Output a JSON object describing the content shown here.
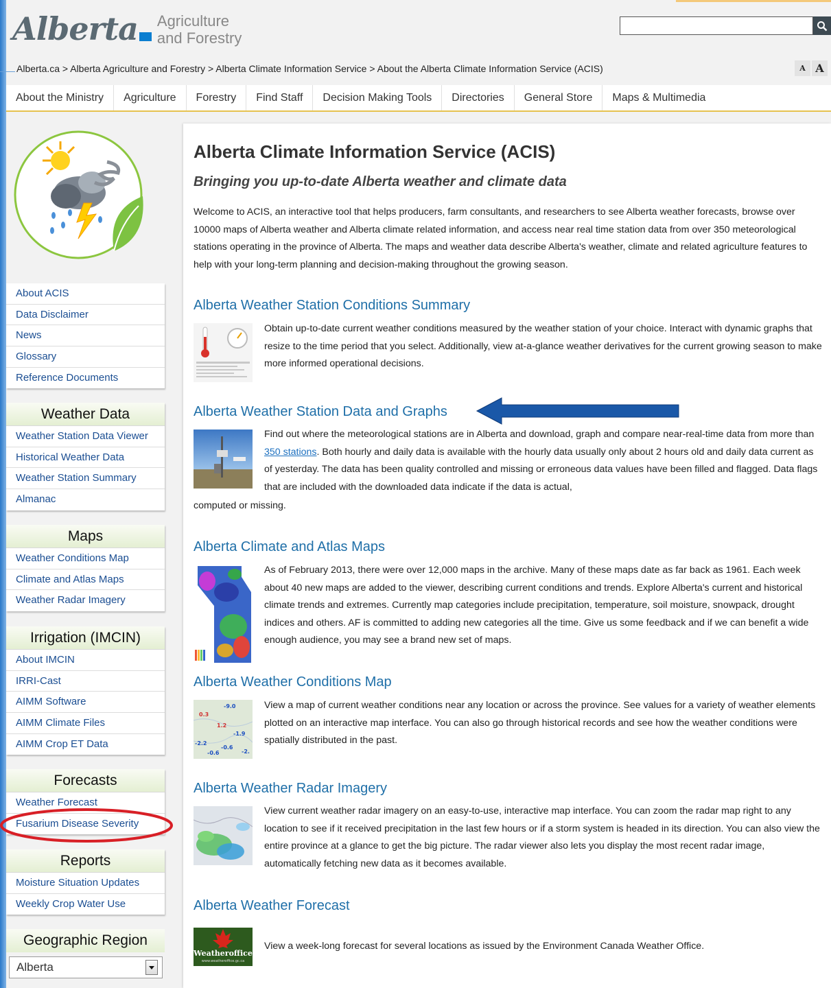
{
  "header": {
    "logo_text": "Alberta",
    "logo_sub_line1": "Agriculture",
    "logo_sub_line2": "and Forestry",
    "search_placeholder": ""
  },
  "breadcrumb": "Alberta.ca > Alberta Agriculture and Forestry > Alberta Climate Information Service > About the Alberta Climate Information Service (ACIS)",
  "font_controls": {
    "small": "A",
    "large": "A"
  },
  "topnav": [
    "About the Ministry",
    "Agriculture",
    "Forestry",
    "Find Staff",
    "Decision Making Tools",
    "Directories",
    "General Store",
    "Maps & Multimedia"
  ],
  "sidebar": {
    "about_group": [
      "About ACIS",
      "Data Disclaimer",
      "News",
      "Glossary",
      "Reference Documents"
    ],
    "weather_data": {
      "heading": "Weather Data",
      "items": [
        "Weather Station Data Viewer",
        "Historical Weather Data",
        "Weather Station Summary",
        "Almanac"
      ]
    },
    "maps": {
      "heading": "Maps",
      "items": [
        "Weather Conditions Map",
        "Climate and Atlas Maps",
        "Weather Radar Imagery"
      ]
    },
    "irrigation": {
      "heading": "Irrigation (IMCIN)",
      "items": [
        "About IMCIN",
        "IRRI-Cast",
        "AIMM Software",
        "AIMM Climate Files",
        "AIMM Crop ET Data"
      ]
    },
    "forecasts": {
      "heading": "Forecasts",
      "items": [
        "Weather Forecast",
        "Fusarium Disease Severity"
      ]
    },
    "reports": {
      "heading": "Reports",
      "items": [
        "Moisture Situation Updates",
        "Weekly Crop Water Use"
      ]
    },
    "region": {
      "heading": "Geographic Region",
      "selected": "Alberta"
    }
  },
  "main": {
    "title": "Alberta Climate Information Service (ACIS)",
    "subtitle": "Bringing you up-to-date Alberta weather and climate data",
    "intro": "Welcome to ACIS, an interactive tool that helps producers, farm consultants, and researchers to see Alberta weather forecasts, browse over 10000 maps of Alberta weather and Alberta climate related information, and access near real time station data from over 350 meteorological stations operating in the province of Alberta. The maps and weather data describe Alberta's weather, climate and related agriculture features to help with your long-term planning and decision-making throughout the growing season.",
    "sections": [
      {
        "title": "Alberta Weather Station Conditions Summary",
        "text": "Obtain up-to-date current weather conditions measured by the weather station of your choice. Interact with dynamic graphs that resize to the time period that you select. Additionally, view at-a-glance weather derivatives for the current growing season to make more informed operational decisions."
      },
      {
        "title": "Alberta Weather Station Data and Graphs",
        "text_before_link": "Find out where the meteorological stations are in Alberta and download, graph and compare near-real-time data from more than ",
        "link": "350 stations",
        "text_after_link": ". Both hourly and daily data is available with the hourly data usually only about 2 hours old and daily data current as of yesterday. The data has been quality controlled and missing or erroneous data values have been filled and flagged. Data flags that are included with the downloaded data indicate if the data is actual,",
        "tail": "computed or missing."
      },
      {
        "title": "Alberta Climate and Atlas Maps",
        "text": "As of February 2013, there were over 12,000 maps in the archive. Many of these maps date as far back as 1961. Each week about 40 new maps are added to the viewer, describing current conditions and trends. Explore Alberta's current and historical climate trends and extremes. Currently map categories include precipitation, temperature, soil moisture, snowpack, drought indices and others. AF is committed to adding new categories all the time. Give us some feedback and if we can benefit a wide enough audience, you may see a brand new set of maps."
      },
      {
        "title": "Alberta Weather Conditions Map",
        "text": "View a map of current weather conditions near any location or across the province. See values for a variety of weather elements plotted on an interactive map interface. You can also go through historical records and see how the weather conditions were spatially distributed in the past.",
        "thumb_values": [
          "-9.0",
          "0.3",
          "1.2",
          "-1.9",
          "-2.2",
          "-0.6",
          "-0.6",
          "-2."
        ]
      },
      {
        "title": "Alberta Weather Radar Imagery",
        "text": "View current weather radar imagery on an easy-to-use, interactive map interface. You can zoom the radar map right to any location to see if it received precipitation in the last few hours or if a storm system is headed in its direction. You can also view the entire province at a glance to get the big picture. The radar viewer also lets you display the most recent radar image, automatically fetching new data as it becomes available."
      },
      {
        "title": "Alberta Weather Forecast",
        "text": "View a week-long forecast for several locations as issued by the Environment Canada Weather Office.",
        "thumb_label": "Weatheroffice",
        "thumb_sublabel": "www.weatheroffice.gc.ca"
      }
    ]
  },
  "colors": {
    "accent_blue_link": "#1f6fa8",
    "menu_link": "#1b4e92",
    "nav_underline": "#e6c24f",
    "annotation_arrow": "#1a58a8",
    "annotation_ellipse": "#d81f26"
  }
}
